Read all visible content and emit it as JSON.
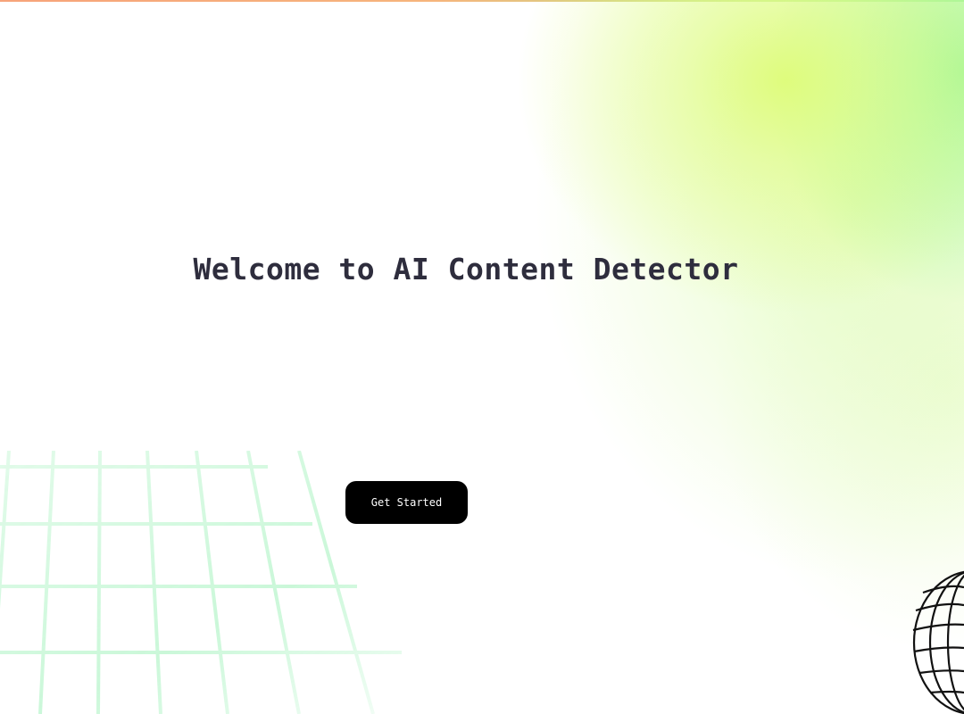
{
  "hero": {
    "title": "Welcome to AI Content Detector",
    "cta_label": "Get Started"
  },
  "colors": {
    "title_text": "#2e2d3d",
    "button_background": "#000000",
    "button_text": "#ffffff",
    "glow_yellow_green": "#defc78",
    "glow_green": "#96f596",
    "grid_line": "#b9f5cc"
  },
  "icons": {
    "decor_bottom_right": "wireframe-globe-icon",
    "decor_bottom_left": "perspective-grid"
  }
}
